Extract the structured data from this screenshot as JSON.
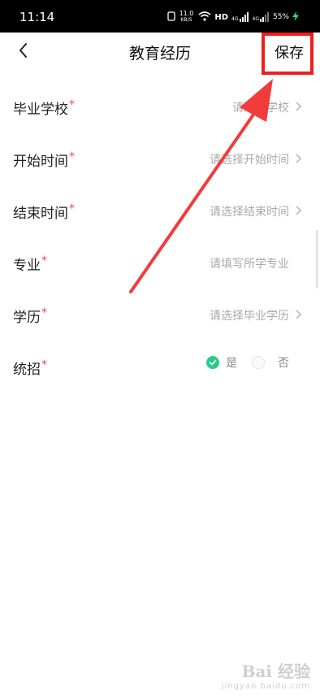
{
  "statusbar": {
    "time": "11:14",
    "net_speed": "11.0",
    "net_unit": "KB/S",
    "hd": "HD",
    "signal1": "4G",
    "signal2": "4G",
    "battery": "55%"
  },
  "header": {
    "title": "教育经历",
    "save_label": "保存",
    "back_icon": "chevron-left-icon"
  },
  "form": {
    "rows": [
      {
        "label": "毕业学校",
        "required_mark": "*",
        "placeholder": "请选择学校"
      },
      {
        "label": "开始时间",
        "required_mark": "*",
        "placeholder": "请选择开始时间"
      },
      {
        "label": "结束时间",
        "required_mark": "*",
        "placeholder": "请选择结束时间"
      },
      {
        "label": "专业",
        "required_mark": "*",
        "placeholder": "请填写所学专业"
      },
      {
        "label": "学历",
        "required_mark": "*",
        "placeholder": "请选择毕业学历"
      }
    ],
    "tongzhao": {
      "label": "统招",
      "required_mark": "*",
      "option_yes": "是",
      "option_no": "否",
      "selected": "是"
    }
  },
  "colors": {
    "accent_green": "#2dc98b",
    "required_red": "#f04a4a",
    "highlight_red": "#f01d1d"
  },
  "watermark": {
    "main": "Bai 经验",
    "sub": "jingyan.baidu.com"
  }
}
